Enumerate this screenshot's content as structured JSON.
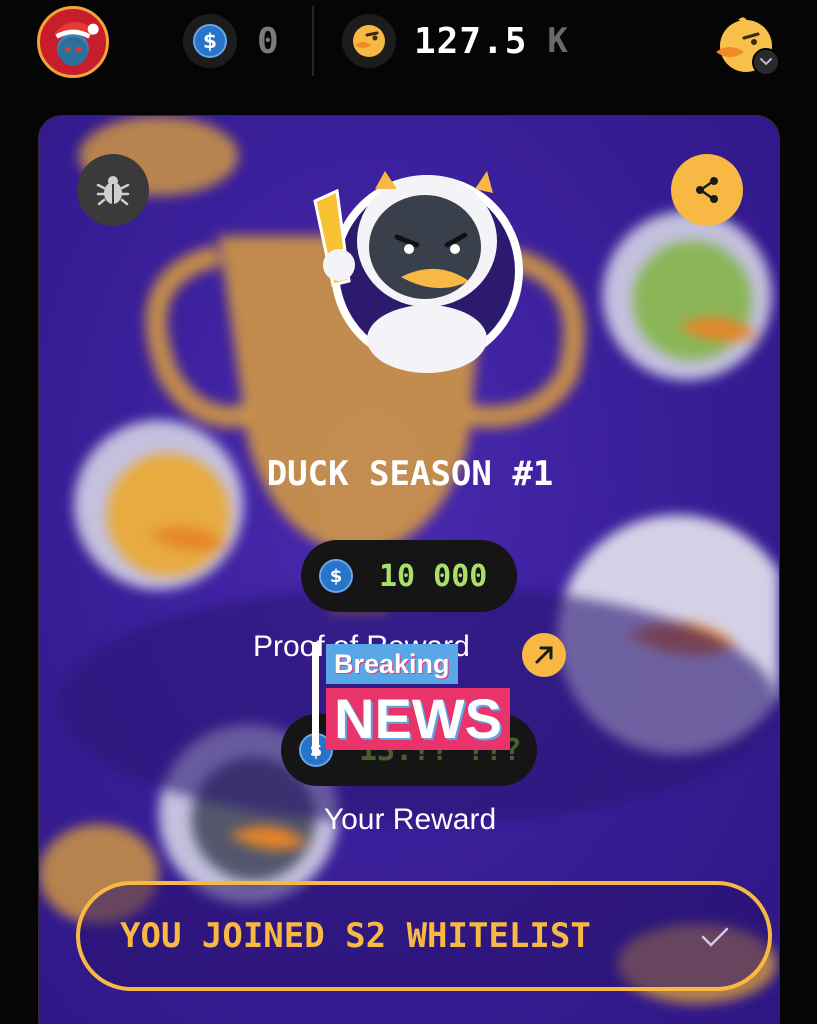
{
  "topbar": {
    "usdc_balance": "0",
    "duck_balance": "127.5",
    "duck_unit": "K"
  },
  "season": {
    "title": "DUCK SEASON #1",
    "prize_pool": "10 000",
    "proof_label": "Proof of Reward",
    "reward_value": "13.?? ???",
    "reward_label": "Your Reward"
  },
  "whitelist": {
    "label": "YOU JOINED S2 WHITELIST"
  },
  "overlay": {
    "top": "Breaking",
    "main": "NEWS"
  },
  "colors": {
    "accent": "#f7b944",
    "prize_green": "#a9e06a",
    "usdc_blue": "#2775ca",
    "card_purple": "#3a1f9a"
  },
  "icons": {
    "user_avatar": "avatar-icon",
    "usdc": "usdc-coin-icon",
    "duck": "duck-coin-icon",
    "bug": "bug-icon",
    "share": "share-icon",
    "arrow": "arrow-up-right-icon",
    "check": "check-icon",
    "chevron": "chevron-down-icon"
  }
}
